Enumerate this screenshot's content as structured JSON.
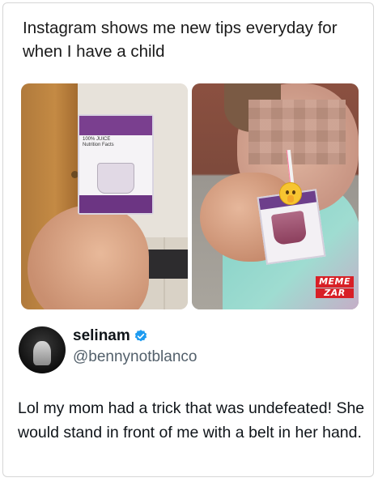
{
  "meme": {
    "caption": "Instagram shows me new tips everyday for when I have a child"
  },
  "photos": {
    "left": {
      "box_label": "100% JUICE",
      "box_sublabel": "Nutrition Facts"
    },
    "right": {
      "watermark_top": "MEME",
      "watermark_bottom": "ZAR"
    }
  },
  "tweet": {
    "display_name": "selinam",
    "handle": "@bennynotblanco",
    "verified": true,
    "text": "Lol my mom had a trick that was undefeated! She would stand in front of me with a belt in her hand."
  },
  "icons": {
    "verified": "verified-badge-icon",
    "emoji": "shushing-face-emoji"
  },
  "colors": {
    "verified_badge": "#1d9bf0",
    "watermark": "#d81f26"
  }
}
